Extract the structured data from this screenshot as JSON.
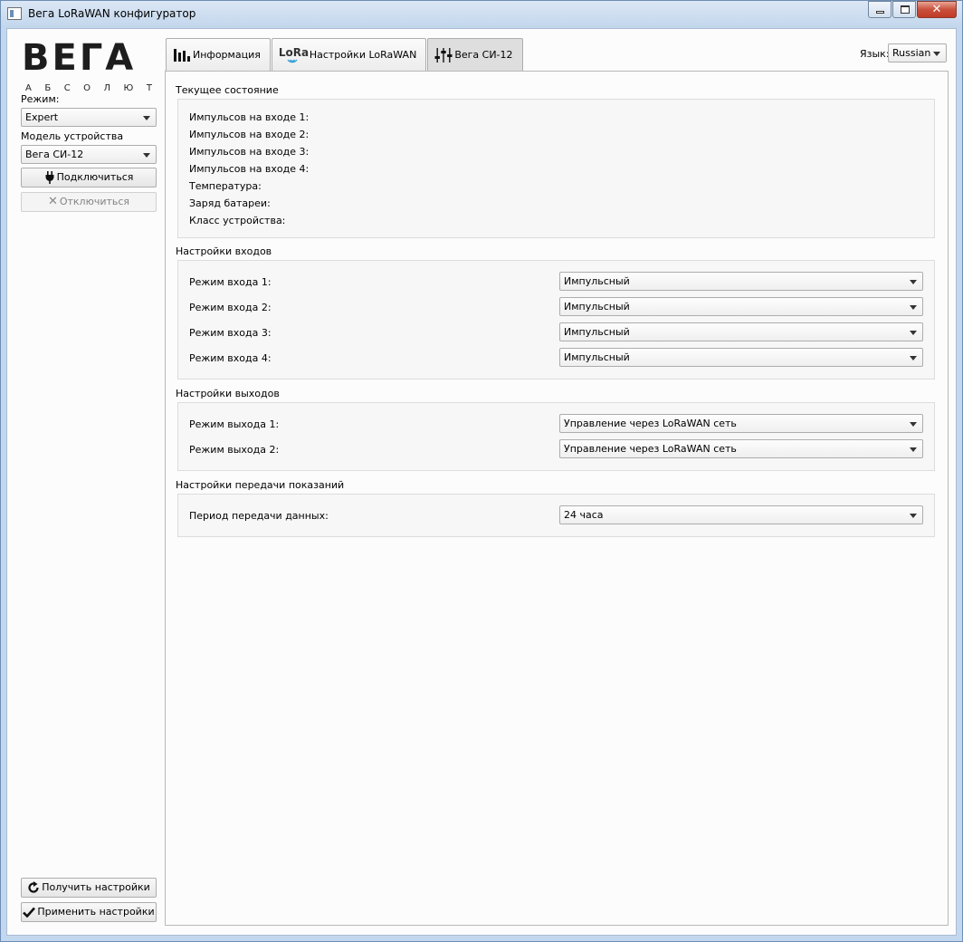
{
  "window": {
    "title": "Вега LoRaWAN конфигуратор"
  },
  "sidebar": {
    "logo_word": "ВЕГА",
    "logo_sub": [
      "А",
      "Б",
      "С",
      "О",
      "Л",
      "Ю",
      "Т"
    ],
    "mode_label": "Режим:",
    "mode_value": "Expert",
    "model_label": "Модель устройства",
    "model_value": "Вега СИ-12",
    "connect_label": "Подключиться",
    "disconnect_label": "Отключиться",
    "get_settings_label": "Получить настройки",
    "apply_settings_label": "Применить настройки"
  },
  "tabs": [
    {
      "label": "Информация",
      "icon": "bar-chart-icon"
    },
    {
      "label": "Настройки LoRaWAN",
      "icon": "lora-icon",
      "icon_text": "LoRa"
    },
    {
      "label": "Вега СИ-12",
      "icon": "sliders-icon",
      "active": true
    }
  ],
  "language": {
    "label": "Язык:",
    "value": "Russian"
  },
  "status": {
    "title": "Текущее состояние",
    "rows": [
      "Импульсов на входе 1:",
      "Импульсов на входе 2:",
      "Импульсов на входе 3:",
      "Импульсов на входе 4:",
      "Температура:",
      "Заряд батареи:",
      "Класс устройства:"
    ]
  },
  "inputs": {
    "title": "Настройки входов",
    "rows": [
      {
        "label": "Режим входа 1:",
        "value": "Импульсный"
      },
      {
        "label": "Режим входа 2:",
        "value": "Импульсный"
      },
      {
        "label": "Режим входа 3:",
        "value": "Импульсный"
      },
      {
        "label": "Режим входа 4:",
        "value": "Импульсный"
      }
    ]
  },
  "outputs": {
    "title": "Настройки выходов",
    "rows": [
      {
        "label": "Режим выхода 1:",
        "value": "Управление через LoRaWAN сеть"
      },
      {
        "label": "Режим выхода 2:",
        "value": "Управление через LoRaWAN сеть"
      }
    ]
  },
  "transmission": {
    "title": "Настройки передачи показаний",
    "rows": [
      {
        "label": "Период передачи данных:",
        "value": "24 часа"
      }
    ]
  }
}
